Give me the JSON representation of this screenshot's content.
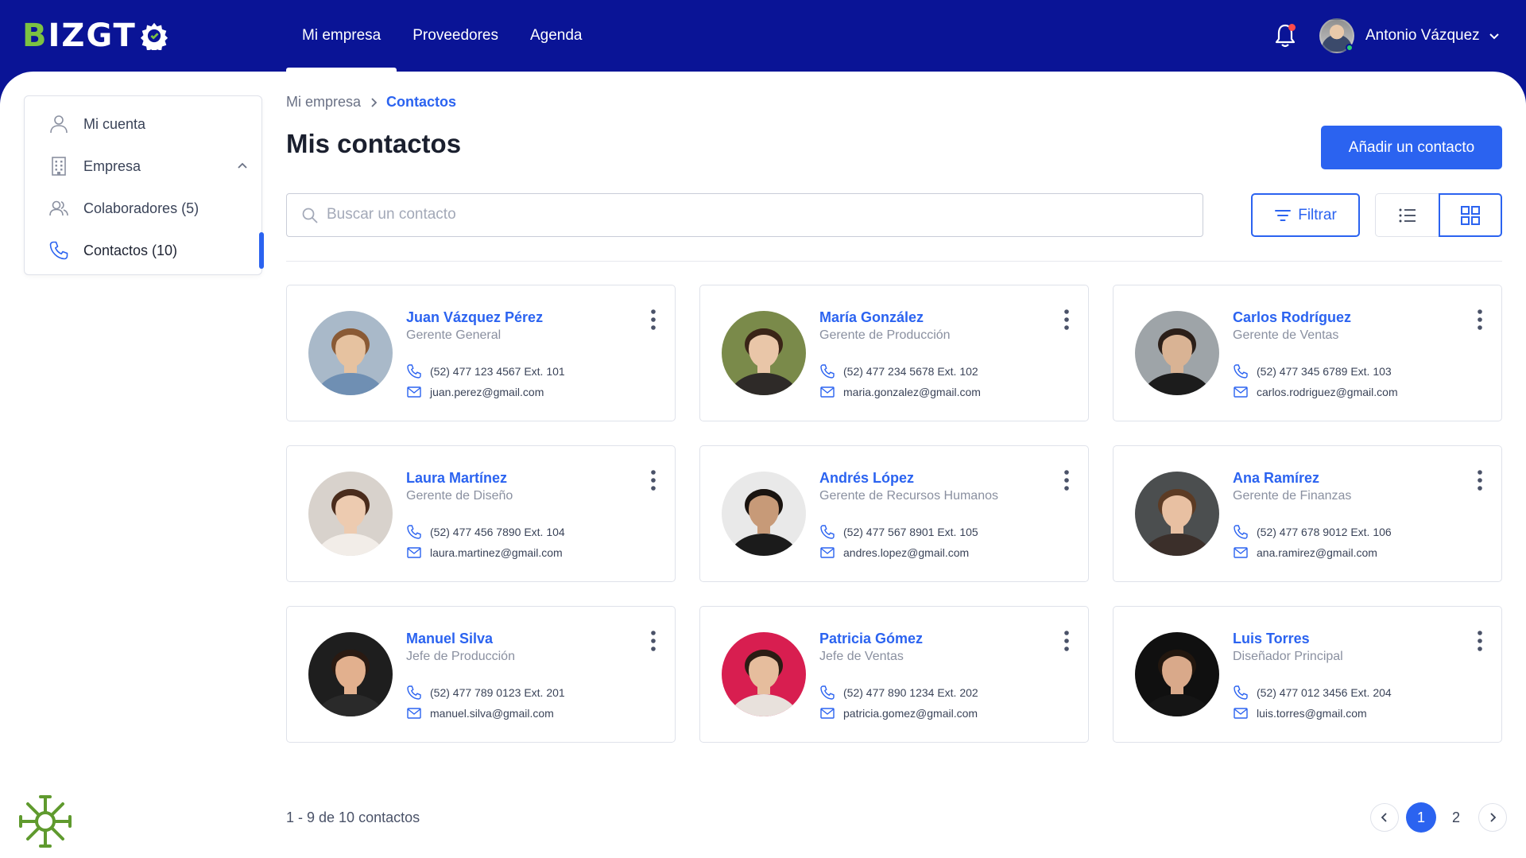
{
  "header": {
    "logo_text_b": "B",
    "logo_text_rest": "IZGT",
    "nav": [
      {
        "label": "Mi empresa",
        "active": true
      },
      {
        "label": "Proveedores",
        "active": false
      },
      {
        "label": "Agenda",
        "active": false
      }
    ],
    "user_name": "Antonio Vázquez"
  },
  "sidebar": {
    "items": [
      {
        "label": "Mi cuenta",
        "icon": "user-icon"
      },
      {
        "label": "Empresa",
        "icon": "building-icon"
      },
      {
        "label": "Colaboradores (5)",
        "icon": "users-icon"
      },
      {
        "label": "Contactos (10)",
        "icon": "phone-icon",
        "active": true
      }
    ]
  },
  "breadcrumb": {
    "parent": "Mi empresa",
    "current": "Contactos"
  },
  "page": {
    "title": "Mis contactos",
    "add_button": "Añadir un contacto",
    "search_placeholder": "Buscar un contacto",
    "filter_button": "Filtrar"
  },
  "contacts": [
    {
      "name": "Juan Vázquez Pérez",
      "role": "Gerente General",
      "phone": "(52) 477 123 4567 Ext. 101",
      "email": "juan.perez@gmail.com",
      "skin": "#e6c2a0",
      "hair": "#8a5a35",
      "bg": "#a9b9c9",
      "shirt": "#6f8fb3"
    },
    {
      "name": "María González",
      "role": "Gerente de Producción",
      "phone": "(52) 477 234 5678 Ext. 102",
      "email": "maria.gonzalez@gmail.com",
      "skin": "#e9c6a8",
      "hair": "#3a2417",
      "bg": "#7a8a4a",
      "shirt": "#2e2a28"
    },
    {
      "name": "Carlos Rodríguez",
      "role": "Gerente de Ventas",
      "phone": "(52) 477 345 6789 Ext. 103",
      "email": "carlos.rodriguez@gmail.com",
      "skin": "#d9b394",
      "hair": "#2b1f19",
      "bg": "#9ea4a8",
      "shirt": "#1c1c1c"
    },
    {
      "name": "Laura Martínez",
      "role": "Gerente de Diseño",
      "phone": "(52) 477 456 7890 Ext. 104",
      "email": "laura.martinez@gmail.com",
      "skin": "#edcbb0",
      "hair": "#4a2c1c",
      "bg": "#d8d2cc",
      "shirt": "#f2ede8"
    },
    {
      "name": "Andrés López",
      "role": "Gerente de Recursos Humanos",
      "phone": "(52) 477 567 8901 Ext. 105",
      "email": "andres.lopez@gmail.com",
      "skin": "#c79a78",
      "hair": "#1a1410",
      "bg": "#e9e9e9",
      "shirt": "#1b1b1b"
    },
    {
      "name": "Ana Ramírez",
      "role": "Gerente de Finanzas",
      "phone": "(52) 477 678 9012 Ext. 106",
      "email": "ana.ramirez@gmail.com",
      "skin": "#e8c0a2",
      "hair": "#5c3b24",
      "bg": "#4b4e4f",
      "shirt": "#3b2f2a"
    },
    {
      "name": "Manuel Silva",
      "role": "Jefe de Producción",
      "phone": "(52) 477 789 0123 Ext. 201",
      "email": "manuel.silva@gmail.com",
      "skin": "#e2b08e",
      "hair": "#2a1a12",
      "bg": "#1e1e1e",
      "shirt": "#2a2a2a"
    },
    {
      "name": "Patricia Gómez",
      "role": "Jefe de Ventas",
      "phone": "(52) 477 890 1234 Ext. 202",
      "email": "patricia.gomez@gmail.com",
      "skin": "#e6bd9d",
      "hair": "#2b1c14",
      "bg": "#d81e50",
      "shirt": "#e8e1dc"
    },
    {
      "name": "Luis Torres",
      "role": "Diseñador Principal",
      "phone": "(52) 477 012 3456 Ext. 204",
      "email": "luis.torres@gmail.com",
      "skin": "#d9a98a",
      "hair": "#22170f",
      "bg": "#101010",
      "shirt": "#151515"
    }
  ],
  "footer": {
    "results": "1 - 9 de 10 contactos",
    "pages": [
      "1",
      "2"
    ],
    "current_page": "1"
  },
  "colors": {
    "header_bg": "#0a1496",
    "accent": "#2b63f0",
    "logo_green": "#7cc242",
    "notification": "#ff4a4a"
  }
}
